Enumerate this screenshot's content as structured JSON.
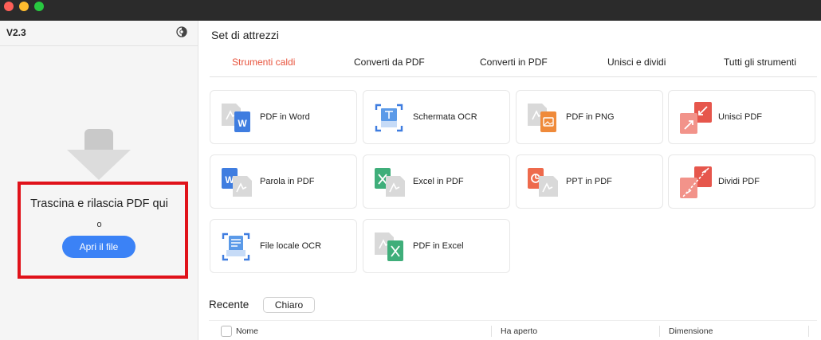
{
  "sidebar": {
    "version": "V2.3",
    "theme_icon": "theme-toggle-icon",
    "drop_text": "Trascina e rilascia PDF qui",
    "or_text": "o",
    "open_button": "Apri il file",
    "highlight_color": "#e0121a",
    "accent_color": "#3b82f6"
  },
  "main": {
    "title": "Set di attrezzi",
    "tabs": [
      {
        "label": "Strumenti caldi",
        "active": true
      },
      {
        "label": "Converti da PDF",
        "active": false
      },
      {
        "label": "Converti in PDF",
        "active": false
      },
      {
        "label": "Unisci e dividi",
        "active": false
      },
      {
        "label": "Tutti gli strumenti",
        "active": false
      }
    ],
    "active_tab_color": "#e8543d",
    "tools": [
      {
        "label": "PDF in Word",
        "icon": "pdf-to-word-icon"
      },
      {
        "label": "Schermata OCR",
        "icon": "screen-ocr-icon"
      },
      {
        "label": "PDF in PNG",
        "icon": "pdf-to-png-icon"
      },
      {
        "label": "Unisci PDF",
        "icon": "merge-pdf-icon"
      },
      {
        "label": "Parola in PDF",
        "icon": "word-to-pdf-icon"
      },
      {
        "label": "Excel in PDF",
        "icon": "excel-to-pdf-icon"
      },
      {
        "label": "PPT in PDF",
        "icon": "ppt-to-pdf-icon"
      },
      {
        "label": "Dividi PDF",
        "icon": "split-pdf-icon"
      },
      {
        "label": "File locale OCR",
        "icon": "local-file-ocr-icon"
      },
      {
        "label": "PDF in Excel",
        "icon": "pdf-to-excel-icon"
      }
    ]
  },
  "recent": {
    "label": "Recente",
    "clear_button": "Chiaro",
    "columns": [
      "Nome",
      "Ha aperto",
      "Dimensione"
    ]
  }
}
